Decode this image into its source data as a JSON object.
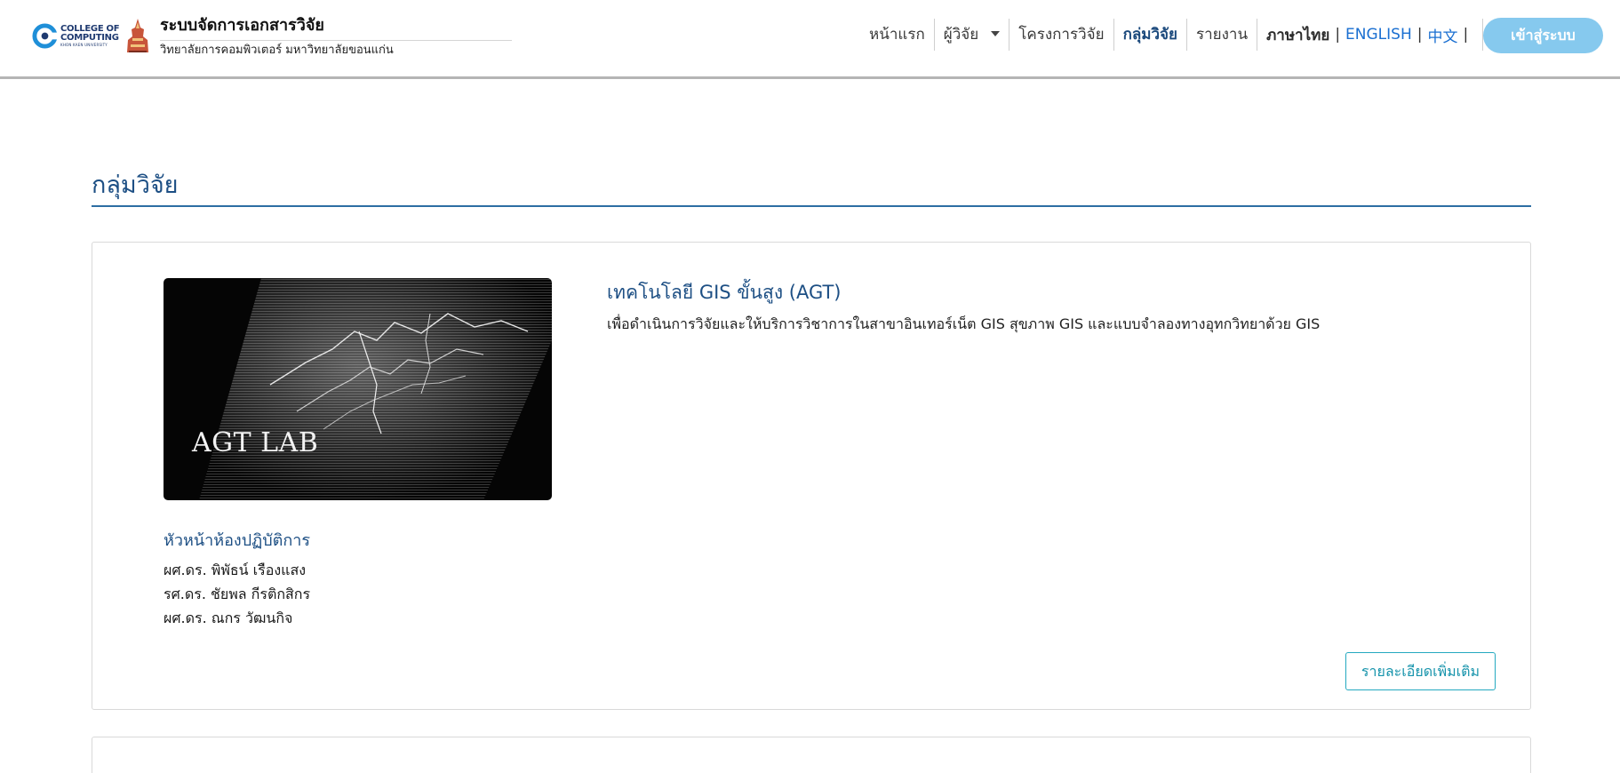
{
  "header": {
    "college_logo_line1": "COLLEGE OF",
    "college_logo_line2": "COMPUTING",
    "college_logo_line3": "KHON KAEN UNIVERSITY",
    "site_title": "ระบบจัดการเอกสารวิจัย",
    "site_subtitle": "วิทยาลัยการคอมพิวเตอร์ มหาวิทยาลัยขอนแก่น",
    "nav": {
      "home": "หน้าแรก",
      "researchers": "ผู้วิจัย",
      "projects": "โครงการวิจัย",
      "groups": "กลุ่มวิจัย",
      "reports": "รายงาน"
    },
    "lang": {
      "thai": "ภาษาไทย",
      "english": "ENGLISH",
      "chinese": "中文",
      "separator": "|"
    },
    "login_label": "เข้าสู่ระบบ"
  },
  "page": {
    "title": "กลุ่มวิจัย"
  },
  "groups": [
    {
      "image_caption": "AGT LAB",
      "name": "เทคโนโลยี GIS ขั้นสูง (AGT)",
      "description": "เพื่อดำเนินการวิจัยและให้บริการวิชาการในสาขาอินเทอร์เน็ต GIS สุขภาพ GIS และแบบจำลองทางอุทกวิทยาด้วย GIS",
      "head_label": "หัวหน้าห้องปฏิบัติการ",
      "members": [
        "ผศ.ดร. พิพัธน์ เรืองแสง",
        "รศ.ดร. ชัยพล กีรติกสิกร",
        "ผศ.ดร. ณกร วัฒนกิจ"
      ],
      "more_label": "รายละเอียดเพิ่มเติม"
    }
  ],
  "colors": {
    "primary_heading": "#1d4f84",
    "login_button": "#86c9ee",
    "link_blue": "#1a6fd1",
    "more_button_border": "#24a9c0"
  },
  "icons": {
    "college_logo": "college-of-computing-logo",
    "university_logo": "khon-kaen-university-logo",
    "dropdown": "caret-down-icon"
  }
}
